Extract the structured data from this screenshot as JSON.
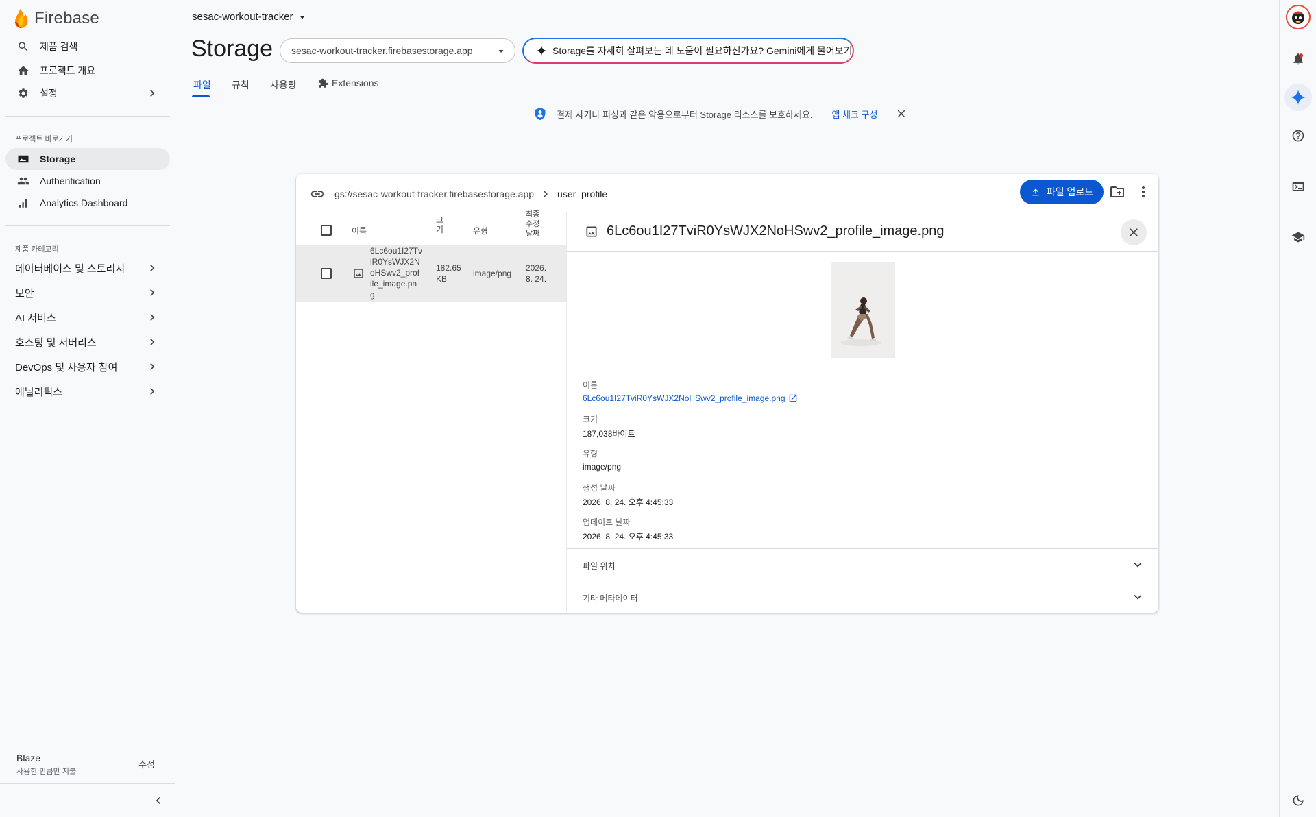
{
  "sidebar": {
    "brand": "Firebase",
    "top_items": [
      {
        "label": "제품 검색",
        "icon": "search-icon"
      },
      {
        "label": "프로젝트 개요",
        "icon": "home-icon"
      },
      {
        "label": "설정",
        "icon": "gear-icon"
      }
    ],
    "shortcuts_label": "프로젝트 바로가기",
    "shortcuts": [
      {
        "label": "Storage",
        "icon": "image-icon",
        "active": true
      },
      {
        "label": "Authentication",
        "icon": "people-icon"
      },
      {
        "label": "Analytics Dashboard",
        "icon": "bar-chart-icon"
      }
    ],
    "categories_label": "제품 카테고리",
    "categories": [
      {
        "label": "데이터베이스 및 스토리지"
      },
      {
        "label": "보안"
      },
      {
        "label": "AI 서비스"
      },
      {
        "label": "호스팅 및 서버리스"
      },
      {
        "label": "DevOps 및 사용자 참여"
      },
      {
        "label": "애널리틱스"
      }
    ],
    "plan": {
      "name": "Blaze",
      "description": "사용한 만큼만 지불",
      "edit_label": "수정"
    }
  },
  "header": {
    "project": "sesac-workout-tracker",
    "title": "Storage",
    "bucket": "sesac-workout-tracker.firebasestorage.app",
    "gemini_prompt": "Storage를 자세히 살펴보는 데 도움이 필요하신가요? Gemini에게 물어보기"
  },
  "tabs": [
    {
      "label": "파일",
      "active": true
    },
    {
      "label": "규칙"
    },
    {
      "label": "사용량"
    },
    {
      "label": "Extensions"
    }
  ],
  "banner": {
    "text": "결제 사기나 피싱과 같은 악용으로부터 Storage 리소스를 보호하세요.",
    "link": "앱 체크 구성"
  },
  "browser": {
    "path_root": "gs://sesac-workout-tracker.firebasestorage.app",
    "path_current": "user_profile",
    "upload_label": "파일 업로드",
    "columns": {
      "name": "이름",
      "size": "크\n기",
      "type": "유형",
      "modified": "최종\n수정\n날짜"
    },
    "rows": [
      {
        "name": "6Lc6ou1I27Tv\niR0YsWJX2N\noHSwv2_prof\nile_image.pn\ng",
        "size": "182.65\nKB",
        "type": "image/png",
        "modified": "2026.\n8. 24."
      }
    ]
  },
  "detail": {
    "filename": "6Lc6ou1I27TviR0YsWJX2NoHSwv2_profile_image.png",
    "name_label": "이름",
    "name_value": "6Lc6ou1I27TviR0YsWJX2NoHSwv2_profile_image.png",
    "size_label": "크기",
    "size_value": "187,038바이트",
    "type_label": "유형",
    "type_value": "image/png",
    "created_label": "생성 날짜",
    "created_value": "2026. 8. 24. 오후 4:45:33",
    "updated_label": "업데이트 날짜",
    "updated_value": "2026. 8. 24. 오후 4:45:33",
    "sections": [
      "파일 위치",
      "기타 메타데이터"
    ]
  },
  "colors": {
    "accent": "#0b57d0",
    "firebase_orange": "#ff9100",
    "firebase_yellow": "#ffc400",
    "firebase_red": "#dd2c00"
  }
}
